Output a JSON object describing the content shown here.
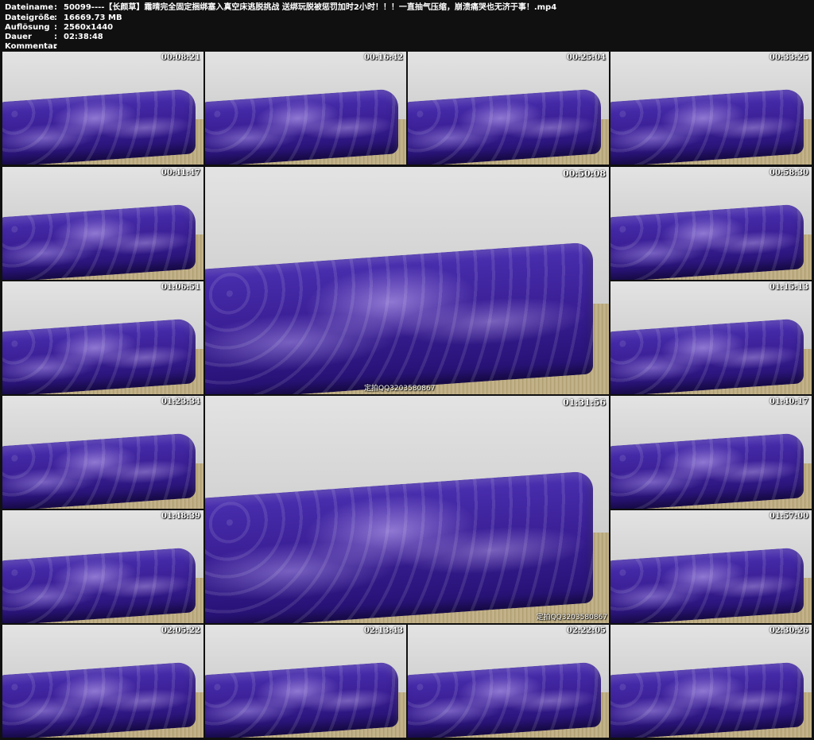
{
  "header": {
    "rows": [
      {
        "key": "Dateiname",
        "value": "50099----【长颜草】霜晴完全固定捆绑塞入真空床逃脱挑战 送绑玩脱被惩罚加时2小时！！！一直抽气压缩，崩溃痛哭也无济于事！.mp4"
      },
      {
        "key": "Dateigröße",
        "value": "16669.73 MB"
      },
      {
        "key": "Auflösung",
        "value": "2560x1440"
      },
      {
        "key": "Dauer",
        "value": "02:38:48"
      },
      {
        "key": "Kommentar",
        "value": ""
      }
    ],
    "separator": ":"
  },
  "thumbnails": [
    {
      "timestamp": "00:08:21"
    },
    {
      "timestamp": "00:16:42"
    },
    {
      "timestamp": "00:25:04"
    },
    {
      "timestamp": "00:33:25"
    },
    {
      "timestamp": "00:41:47"
    },
    {
      "timestamp": "00:50:08",
      "watermark": "定拍QQ3203580867"
    },
    {
      "timestamp": "00:58:30"
    },
    {
      "timestamp": "01:06:51"
    },
    {
      "timestamp": "01:15:13"
    },
    {
      "timestamp": "01:23:34"
    },
    {
      "timestamp": "01:31:56",
      "watermark": "定拍QQ3203580867"
    },
    {
      "timestamp": "01:40:17"
    },
    {
      "timestamp": "01:48:39"
    },
    {
      "timestamp": "01:57:00"
    },
    {
      "timestamp": "02:05:22"
    },
    {
      "timestamp": "02:13:43"
    },
    {
      "timestamp": "02:22:05"
    },
    {
      "timestamp": "02:30:26"
    }
  ],
  "colors": {
    "background": "#101010",
    "header_text": "#ffffff",
    "mattress": "#3a1f96"
  }
}
